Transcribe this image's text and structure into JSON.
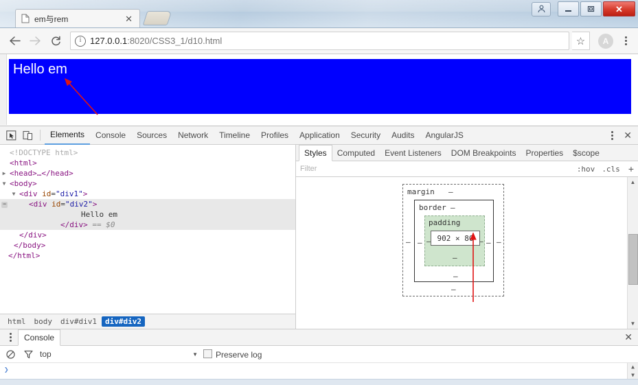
{
  "window": {
    "user_icon": "user-account-icon",
    "minimize_label": "—",
    "maximize_label": "❐",
    "close_label": "✕"
  },
  "tabstrip": {
    "tab_title": "em与rem",
    "tab_favicon": "page-icon",
    "tab_close_label": "✕",
    "new_tab_label": "+"
  },
  "navbar": {
    "back_label": "←",
    "forward_label": "→",
    "reload_label": "⟳",
    "info_label": "ⓘ",
    "url_host": "127.0.0.1",
    "url_rest": ":8020/CSS3_1/d10.html",
    "url_full": "127.0.0.1:8020/CSS3_1/d10.html",
    "star_label": "☆",
    "extension_label": "A",
    "menu_label": "kebab-menu"
  },
  "page": {
    "div_text": "Hello em",
    "div_bg": "#0000ff",
    "div_color": "#ffffff"
  },
  "devtools": {
    "inspect_icon": "inspect-element-icon",
    "device_icon": "device-toolbar-icon",
    "tabs": [
      {
        "label": "Elements",
        "active": true
      },
      {
        "label": "Console",
        "active": false
      },
      {
        "label": "Sources",
        "active": false
      },
      {
        "label": "Network",
        "active": false
      },
      {
        "label": "Timeline",
        "active": false
      },
      {
        "label": "Profiles",
        "active": false
      },
      {
        "label": "Application",
        "active": false
      },
      {
        "label": "Security",
        "active": false
      },
      {
        "label": "Audits",
        "active": false
      },
      {
        "label": "AngularJS",
        "active": false
      }
    ],
    "more_label": "kebab-menu",
    "close_label": "✕"
  },
  "dom": {
    "lines": [
      "<!DOCTYPE html>",
      "<html>",
      "<head>…</head>",
      "<body>",
      "<div id=\"div1\">",
      "<div id=\"div2\">",
      "Hello em",
      "</div> == $0",
      "</div>",
      "</body>",
      "</html>"
    ],
    "doctype": "<!DOCTYPE html>",
    "html_open": "<html>",
    "head_collapsed": "<head>…</head>",
    "body_open": "<body>",
    "div1_tag": "div",
    "div1_attr": "id",
    "div1_val": "\"div1\"",
    "div2_tag": "div",
    "div2_attr": "id",
    "div2_val": "\"div2\"",
    "inner_text": "Hello em",
    "div2_close": "</div>",
    "selected_ref": "== $0",
    "div1_close": "</div>",
    "body_close": "</body>",
    "html_close": "</html>"
  },
  "breadcrumb": {
    "items": [
      {
        "label": "html",
        "active": false
      },
      {
        "label": "body",
        "active": false
      },
      {
        "label": "div#div1",
        "active": false
      },
      {
        "label": "div#div2",
        "active": true
      }
    ]
  },
  "styles": {
    "tabs": [
      {
        "label": "Styles",
        "active": true
      },
      {
        "label": "Computed",
        "active": false
      },
      {
        "label": "Event Listeners",
        "active": false
      },
      {
        "label": "DOM Breakpoints",
        "active": false
      },
      {
        "label": "Properties",
        "active": false
      },
      {
        "label": "$scope",
        "active": false
      }
    ],
    "filter_placeholder": "Filter",
    "hov_label": ":hov",
    "cls_label": ".cls",
    "add_label": "+"
  },
  "box_model": {
    "margin_label": "margin",
    "margin_top": "–",
    "margin_right": "–",
    "margin_bottom": "–",
    "margin_left": "–",
    "border_label": "border",
    "border_top": "–",
    "border_right": "–",
    "border_bottom": "–",
    "border_left": "–",
    "padding_label": "padding",
    "padding_top": "",
    "padding_right": "–",
    "padding_bottom": "–",
    "padding_left": "–",
    "content_size": "902 × 80",
    "content_width": 902,
    "content_height": 80,
    "padding_color": "#cfe5cd"
  },
  "drawer": {
    "menu_label": "kebab-menu",
    "tab_label": "Console",
    "close_label": "✕",
    "clear_icon": "clear-console-icon",
    "filter_icon": "filter-icon",
    "context_value": "top",
    "context_caret": "▼",
    "preserve_log_label": "Preserve log",
    "preserve_log_checked": false,
    "prompt_label": "❯"
  },
  "scrollbar": {
    "up_label": "▲",
    "down_label": "▼"
  }
}
